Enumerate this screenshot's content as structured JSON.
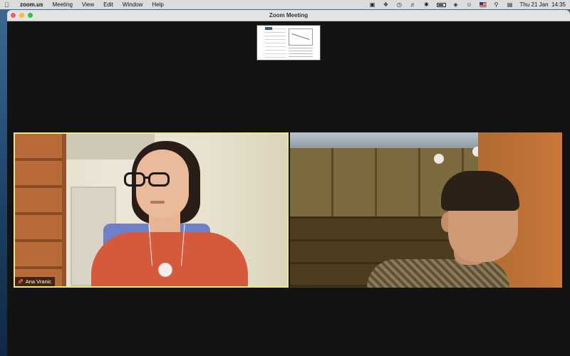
{
  "menubar": {
    "app_name": "zoom.us",
    "menus": [
      "Meeting",
      "View",
      "Edit",
      "Window",
      "Help"
    ],
    "clock": "Thu 21 Jan  14:35",
    "tray_icons": [
      "zoom-icon",
      "dropbox-icon",
      "time-machine-icon",
      "volume-icon",
      "bluetooth-icon",
      "battery-icon",
      "wifi-icon",
      "user-icon",
      "flag-icon",
      "search-icon",
      "control-center-icon"
    ]
  },
  "window": {
    "title": "Zoom Meeting"
  },
  "participants": [
    {
      "name": "Ana Vranic",
      "pinned": true,
      "active_speaker": true
    },
    {
      "name": "",
      "pinned": false,
      "active_speaker": false
    }
  ],
  "colors": {
    "active_speaker_border": "#e7e87e",
    "window_bg": "#131313"
  }
}
